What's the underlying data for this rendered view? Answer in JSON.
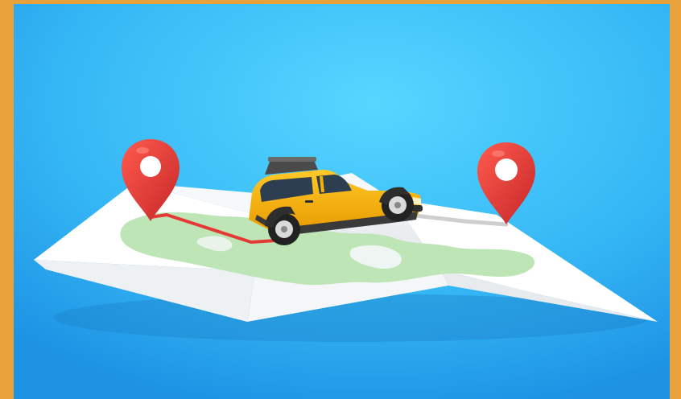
{
  "scene": {
    "description_icons": [
      "start-pin-icon",
      "end-pin-icon",
      "suv-car-icon",
      "folded-map-icon",
      "route-line-icon"
    ],
    "colors": {
      "frame": "#E8A23C",
      "sky_light": "#4FD0FF",
      "sky_dark": "#1E9BE8",
      "map_paper": "#FFFFFF",
      "map_land": "#BDE5B5",
      "route_done": "#E53935",
      "route_remaining": "#CFCFCF",
      "pin": "#E53935",
      "car_body": "#F5B400",
      "car_dark": "#2E2E2E"
    }
  }
}
